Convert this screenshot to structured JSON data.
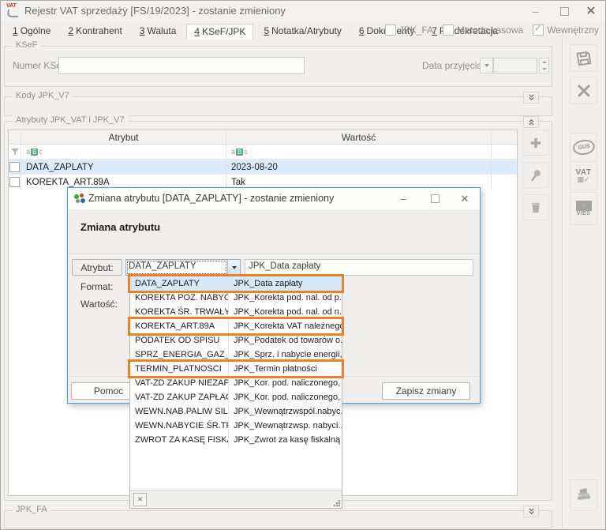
{
  "window": {
    "title": "Rejestr VAT sprzedaży [FS/19/2023] - zostanie zmieniony"
  },
  "tabs": [
    {
      "num": "1",
      "label": "Ogólne"
    },
    {
      "num": "2",
      "label": "Kontrahent"
    },
    {
      "num": "3",
      "label": "Waluta"
    },
    {
      "num": "4",
      "label": "KSeF/JPK",
      "active": true
    },
    {
      "num": "5",
      "label": "Notatka/Atrybuty"
    },
    {
      "num": "6",
      "label": "Dokumenty"
    },
    {
      "num": "7",
      "label": "Predekretacja"
    }
  ],
  "header_flags": [
    {
      "label": "JPK_FA",
      "checked": false
    },
    {
      "label": "Metoda kasowa",
      "checked": false
    },
    {
      "label": "Wewnętrzny",
      "checked": true
    }
  ],
  "ksef": {
    "legend": "KSeF",
    "numer_label": "Numer KSeF",
    "numer_value": "",
    "data_label": "Data przyjęcia",
    "data_value": ""
  },
  "kody": {
    "legend": "Kody JPK_V7"
  },
  "atrybuty": {
    "legend": "Atrybuty JPK_VAT i JPK_V7",
    "col_atrybut": "Atrybut",
    "col_wartosc": "Wartość",
    "rows": [
      {
        "atrybut": "DATA_ZAPLATY",
        "wartosc": "2023-08-20",
        "selected": true
      },
      {
        "atrybut": "KOREKTA_ART.89A",
        "wartosc": "Tak",
        "selected": false
      }
    ]
  },
  "jpk_fa": {
    "legend": "JPK_FA"
  },
  "side_toolbar": {
    "gus": "GUS",
    "vat": "VAT",
    "vies": "VIES"
  },
  "dialog": {
    "title": "Zmiana atrybutu [DATA_ZAPLATY] - zostanie zmieniony",
    "heading": "Zmiana atrybutu",
    "atrybut_label": "Atrybut:",
    "atrybut_value": "DATA_ZAPLATY",
    "atrybut_desc": "JPK_Data zapłaty",
    "format_label": "Format:",
    "wartosc_label": "Wartość:",
    "pomoc": "Pomoc",
    "zapisz": "Zapisz zmiany"
  },
  "dropdown": {
    "items": [
      {
        "code": "DATA_ZAPLATY",
        "desc": "JPK_Data zapłaty",
        "selected": true,
        "highlighted": true
      },
      {
        "code": "KOREKTA POZ. NABYĆ",
        "desc": "JPK_Korekta pod. nal. od p...",
        "selected": false,
        "highlighted": false
      },
      {
        "code": "KOREKTA ŚR. TRWAŁYCH",
        "desc": "JPK_Korekta pod. nal. od n...",
        "selected": false,
        "highlighted": false
      },
      {
        "code": "KOREKTA_ART.89A",
        "desc": "JPK_Korekta VAT należnego...",
        "selected": false,
        "highlighted": true
      },
      {
        "code": "PODATEK OD SPISU",
        "desc": "JPK_Podatek od towarów o...",
        "selected": false,
        "highlighted": false
      },
      {
        "code": "SPRZ_ENERGIA_GAZ_OO",
        "desc": "JPK_Sprz. i nabycie energii,...",
        "selected": false,
        "highlighted": false
      },
      {
        "code": "TERMIN_PLATNOSCI",
        "desc": "JPK_Termin płatności",
        "selected": false,
        "highlighted": true
      },
      {
        "code": "VAT-ZD ZAKUP NIEZAPŁ",
        "desc": "JPK_Kor. pod. naliczonego, ...",
        "selected": false,
        "highlighted": false
      },
      {
        "code": "VAT-ZD ZAKUP ZAPŁAC.",
        "desc": "JPK_Kor. pod. naliczonego, ...",
        "selected": false,
        "highlighted": false
      },
      {
        "code": "WEWN.NAB.PALIW SILN.",
        "desc": "JPK_Wewnątrzwspól.nabyc...",
        "selected": false,
        "highlighted": false
      },
      {
        "code": "WEWN.NABYCIE ŚR.TRAN",
        "desc": "JPK_Wewnątrzwsp. nabyci...",
        "selected": false,
        "highlighted": false
      },
      {
        "code": "ZWROT ZA KASĘ FISKAL",
        "desc": "JPK_Zwrot za kasę fiskalną",
        "selected": false,
        "highlighted": false
      }
    ]
  },
  "colors": {
    "highlight_orange": "#ef8125",
    "dialog_border": "#46a1da",
    "selection_blue": "#dcebfb"
  }
}
